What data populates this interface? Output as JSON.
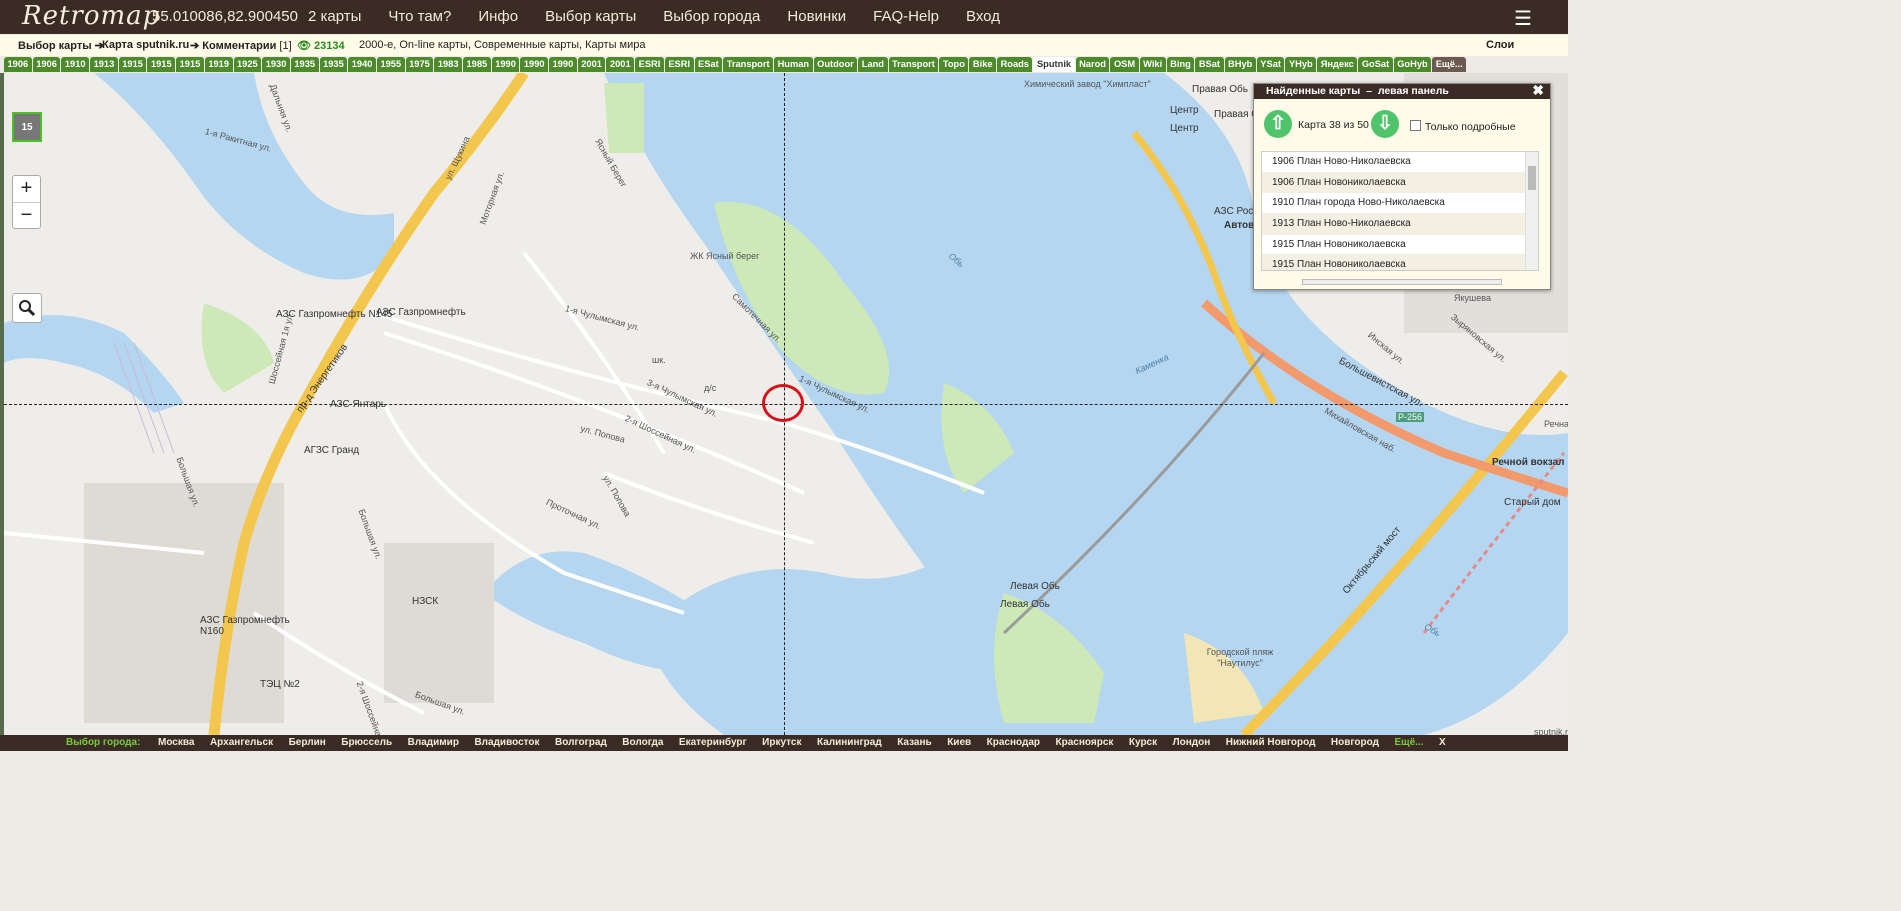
{
  "header": {
    "logo": "Retromap",
    "coordinates": "55.010086,82.900450",
    "nav": [
      "2 карты",
      "Что там?",
      "Инфо",
      "Выбор карты",
      "Выбор города",
      "Новинки",
      "FAQ-Help",
      "Вход"
    ],
    "menu_icon": "hamburger-menu-icon"
  },
  "breadcrumb": {
    "choose_map": "Выбор карты",
    "arrow": "➔",
    "map_source": "Карта sputnik.ru",
    "comments": "Комментарии",
    "comments_count": "[1]",
    "views": "23134",
    "tags": "2000-е, On-line карты, Современные карты, Карты мира",
    "layers": "Слои"
  },
  "tabs": [
    "1906",
    "1906",
    "1910",
    "1913",
    "1915",
    "1915",
    "1915",
    "1919",
    "1925",
    "1930",
    "1935",
    "1935",
    "1940",
    "1955",
    "1975",
    "1983",
    "1985",
    "1990",
    "1990",
    "1990",
    "2001",
    "2001",
    "ESRI",
    "ESRI",
    "ESat",
    "Transport",
    "Human",
    "Outdoor",
    "Land",
    "Transport",
    "Topo",
    "Bike",
    "Roads",
    "Sputnik",
    "Narod",
    "OSM",
    "Wiki",
    "Bing",
    "BSat",
    "BHyb",
    "YSat",
    "YHyb",
    "Яндекс",
    "GoSat",
    "GoHyb",
    "Ещё..."
  ],
  "selected_tab": "Sputnik",
  "map": {
    "zoom_level": "15",
    "zoom_in": "+",
    "zoom_out": "−",
    "labels": [
      "Химический завод \"Химпласт\"",
      "Правая Обь",
      "Правая Обь",
      "Центр",
      "Центр",
      "1-я Ракитная ул.",
      "Дальняя ул.",
      "ул. Щукина",
      "Моторная ул.",
      "Ясный Берег",
      "ЖК Ясный берег",
      "Обь",
      "АЗС Роснефть",
      "Автовокзал Новосибирск",
      "АЗС Газпромнефть N145",
      "АЗС Газпромнефть",
      "1-я Чулымская ул.",
      "Самотечная ул.",
      "шк.",
      "д/с",
      "Шоссейная 1я ул.",
      "пр-д Энергетиков",
      "АЗС Янтарь",
      "3-я Чулымская ул.",
      "1-я Чулымская ул.",
      "2-я Шоссейная ул.",
      "ул. Попова",
      "Каменка",
      "Большевистская ул.",
      "Инская ул.",
      "Зыряновская ул.",
      "Якушева",
      "Михайловская наб.",
      "Р-256",
      "Речной вокзал",
      "Старый дом",
      "АГЗС Гранд",
      "Большая ул.",
      "ул. Попова",
      "Проточная ул.",
      "Октябрьский мост",
      "Большая ул.",
      "НЗСК",
      "Левая Обь",
      "Левая Обь",
      "АЗС Газпромнефть N160",
      "ТЭЦ №2",
      "Городской пляж \"Наутилус\"",
      "Обь",
      "sputnik.ru",
      "2-я Шоссейная ул.",
      "Большая ул.",
      "Речная ул."
    ]
  },
  "panel": {
    "title": "Найденные карты",
    "dash": "–",
    "subtitle": "левая панель",
    "counter": "Карта 38 из 50",
    "only_detailed": "Только подробные",
    "items": [
      "1906 План Ново-Николаевска",
      "1906 План Новониколаевска",
      "1910 План города Ново-Николаевска",
      "1913 План Ново-Николаевска",
      "1915 План Новониколаевска",
      "1915 План Новониколаевска"
    ]
  },
  "footer": {
    "label": "Выбор города:",
    "cities": [
      "Москва",
      "Архангельск",
      "Берлин",
      "Брюссель",
      "Владимир",
      "Владивосток",
      "Волгоград",
      "Вологда",
      "Екатеринбург",
      "Иркутск",
      "Калининград",
      "Казань",
      "Киев",
      "Краснодар",
      "Красноярск",
      "Курск",
      "Лондон",
      "Нижний Новгород",
      "Новгород"
    ],
    "more": "Ещё...",
    "close": "X"
  }
}
